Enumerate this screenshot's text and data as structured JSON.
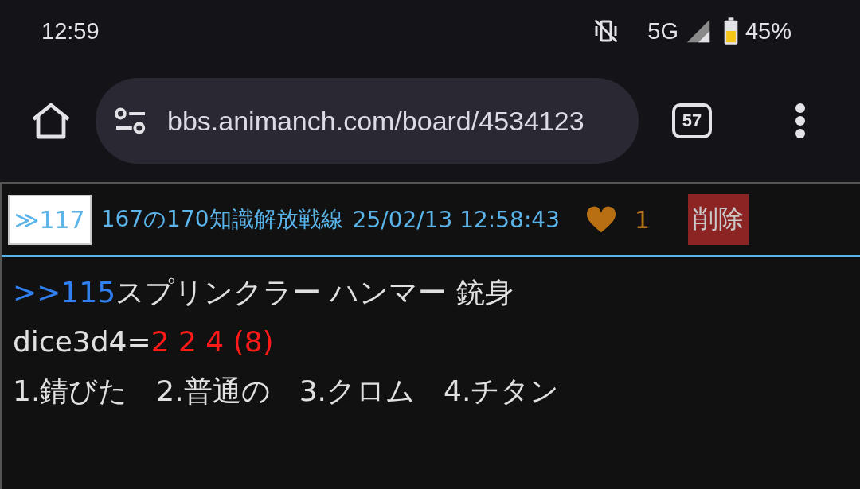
{
  "status_bar": {
    "time": "12:59",
    "network": "5G",
    "battery": "45%"
  },
  "toolbar": {
    "url": "bbs.animanch.com/board/4534123",
    "tab_count": "57"
  },
  "post": {
    "anchor": "≫117",
    "author": "167の170知識解放戦線",
    "date": "25/02/13 12:58:43",
    "likes": "1",
    "delete": "削除",
    "body": [
      [
        {
          "kind": "link",
          "text": ">>115"
        },
        {
          "kind": "text",
          "text": "スプリンクラー ハンマー 銃身"
        }
      ],
      [
        {
          "kind": "text",
          "text": "dice3d4="
        },
        {
          "kind": "dice",
          "text": "2 2 4 (8)"
        }
      ],
      [
        {
          "kind": "text",
          "text": "1.錆びた　2.普通の　3.クロム　4.チタン"
        }
      ]
    ]
  }
}
